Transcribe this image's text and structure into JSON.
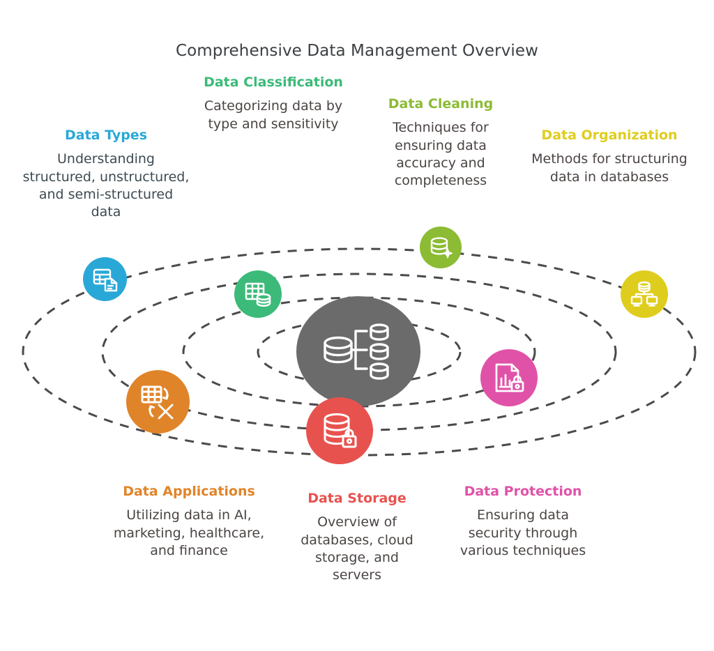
{
  "title": "Comprehensive Data Management Overview",
  "colors": {
    "title_text": "#3c4043",
    "body_text": "#4a4442",
    "hub": "#6b6b6b",
    "ring_stroke": "#4a4a4a",
    "background": "#ffffff"
  },
  "hub": {
    "icon": "distributed-database-icon",
    "color": "#6b6b6b"
  },
  "nodes": [
    {
      "id": "data-types",
      "title": "Data Types",
      "description": "Understanding structured, unstructured, and semi-structured data",
      "color": "#29a8d8",
      "icon": "table-document-icon"
    },
    {
      "id": "data-classification",
      "title": "Data Classification",
      "description": "Categorizing data by type and sensitivity",
      "color": "#3cba79",
      "icon": "table-database-icon"
    },
    {
      "id": "data-cleaning",
      "title": "Data Cleaning",
      "description": "Techniques for ensuring data accuracy and completeness",
      "color": "#8cbb34",
      "icon": "database-sparkle-icon"
    },
    {
      "id": "data-organization",
      "title": "Data Organization",
      "description": "Methods for structuring data in databases",
      "color": "#dfcd1d",
      "icon": "database-network-icon"
    },
    {
      "id": "data-protection",
      "title": "Data Protection",
      "description": "Ensuring data security through various techniques",
      "color": "#e052a8",
      "icon": "document-chart-lock-icon"
    },
    {
      "id": "data-storage",
      "title": "Data Storage",
      "description": "Overview of databases, cloud storage, and servers",
      "color": "#e8524e",
      "icon": "database-lock-icon"
    },
    {
      "id": "data-applications",
      "title": "Data Applications",
      "description": "Utilizing data in AI, marketing, healthcare, and finance",
      "color": "#e08429",
      "icon": "table-convert-icon"
    }
  ]
}
